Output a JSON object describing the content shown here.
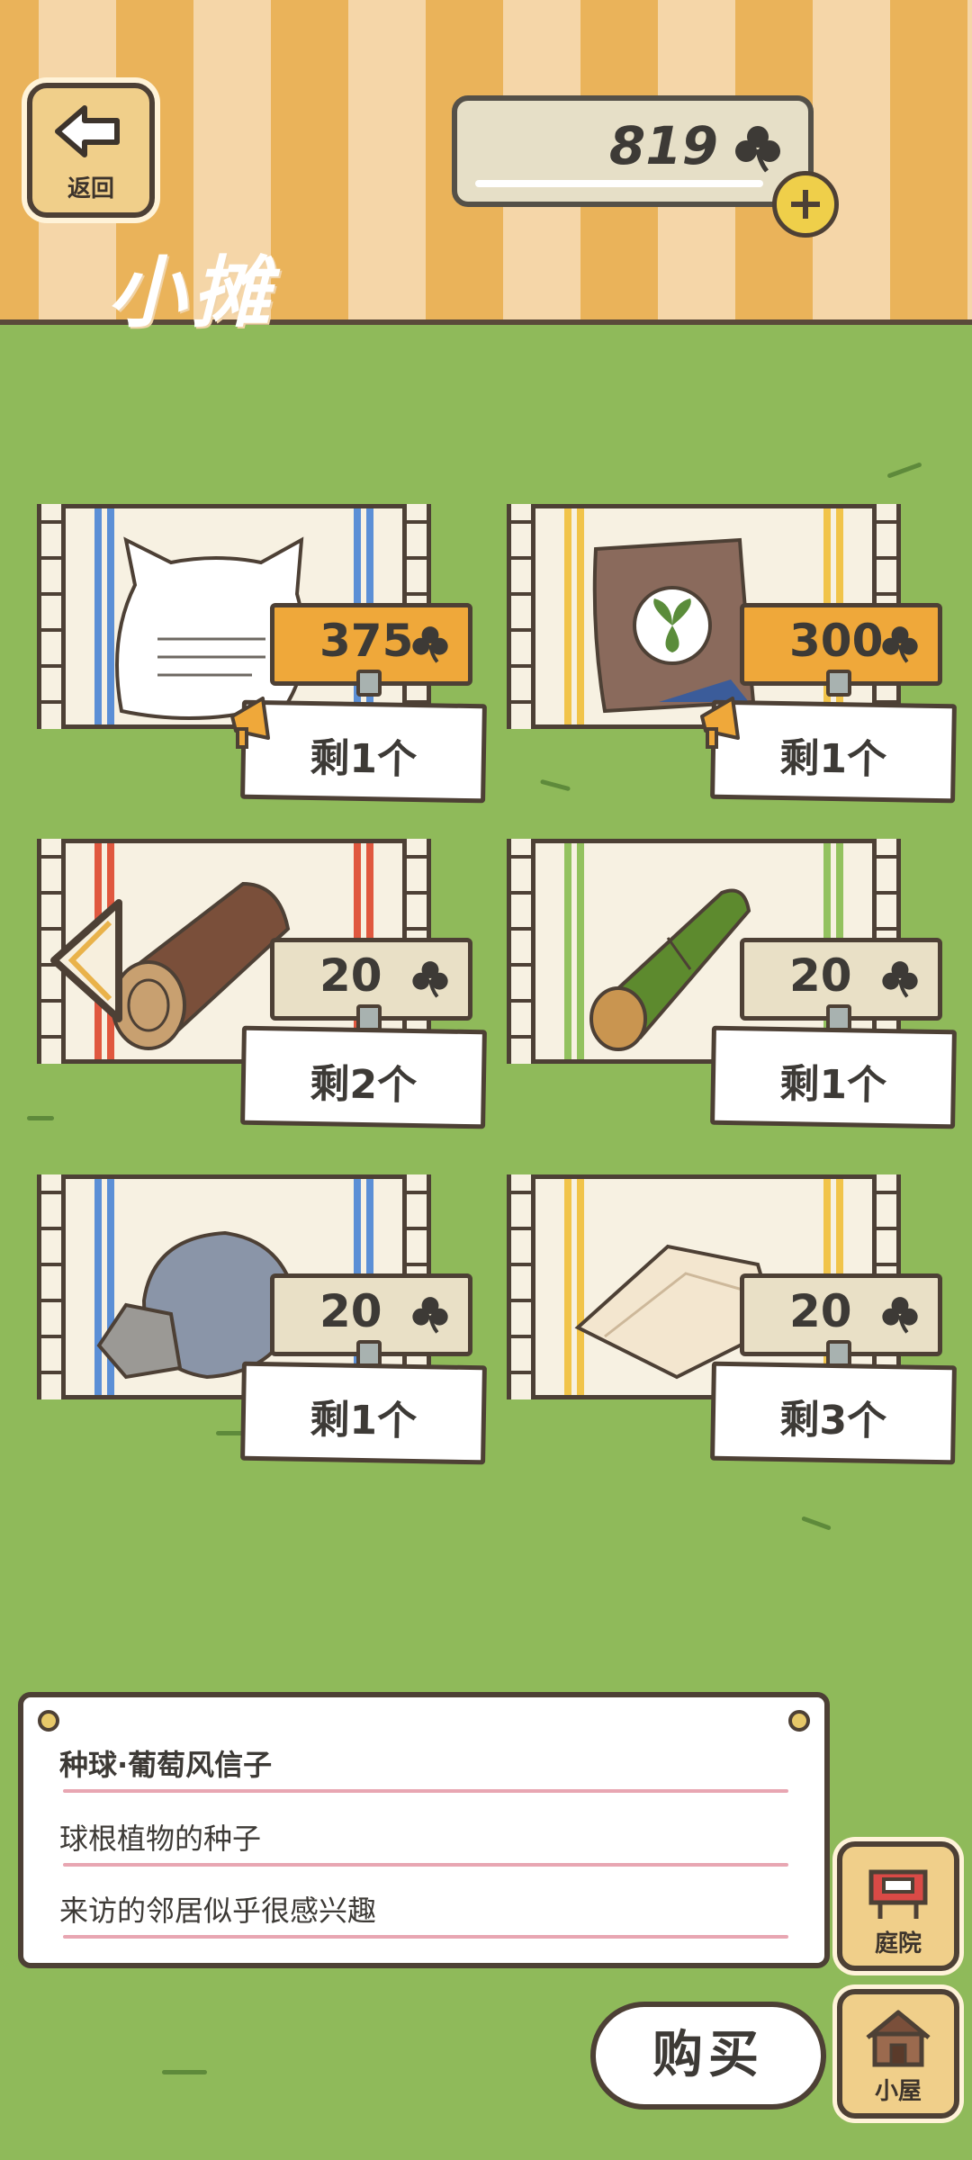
{
  "header": {
    "back_label": "返回",
    "coins": "819",
    "title": "小摊"
  },
  "items": [
    {
      "price": "375",
      "stock": "剩1个",
      "price_style": "orange",
      "stripe_color": "#5b8fd6",
      "art": "cat-cushion"
    },
    {
      "price": "300",
      "stock": "剩1个",
      "price_style": "orange",
      "stripe_color": "#f1c44a",
      "art": "seed-bag"
    },
    {
      "price": "20",
      "stock": "剩2个",
      "price_style": "beige",
      "stripe_color": "#e0583f",
      "art": "wood-log"
    },
    {
      "price": "20",
      "stock": "剩1个",
      "price_style": "beige",
      "stripe_color": "#93c25f",
      "art": "bamboo"
    },
    {
      "price": "20",
      "stock": "剩1个",
      "price_style": "beige",
      "stripe_color": "#5b8fd6",
      "art": "stone"
    },
    {
      "price": "20",
      "stock": "剩3个",
      "price_style": "beige",
      "stripe_color": "#f1c44a",
      "art": "cloth-cushion"
    }
  ],
  "description": {
    "line1": "种球·葡萄风信子",
    "line2": "球根植物的种子",
    "line3": "来访的邻居似乎很感兴趣"
  },
  "buttons": {
    "buy": "购买",
    "yard": "庭院",
    "house": "小屋"
  },
  "colors": {
    "grass": "#8fba5a",
    "outline": "#4d4035",
    "sale_tag": "#efa83a",
    "button_wood": "#f0cf8a"
  }
}
